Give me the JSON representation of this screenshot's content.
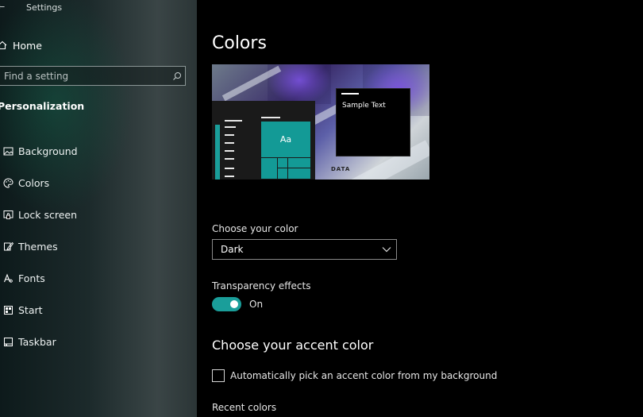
{
  "window": {
    "title": "Settings"
  },
  "sidebar": {
    "home_label": "Home",
    "search_placeholder": "Find a setting",
    "section_title": "Personalization",
    "items": [
      {
        "label": "Background",
        "icon": "picture-icon"
      },
      {
        "label": "Colors",
        "icon": "palette-icon"
      },
      {
        "label": "Lock screen",
        "icon": "lock-screen-icon"
      },
      {
        "label": "Themes",
        "icon": "brush-icon"
      },
      {
        "label": "Fonts",
        "icon": "font-icon"
      },
      {
        "label": "Start",
        "icon": "start-menu-icon"
      },
      {
        "label": "Taskbar",
        "icon": "taskbar-icon"
      }
    ]
  },
  "main": {
    "title": "Colors",
    "preview": {
      "tile_text": "Aa",
      "sample_text": "Sample Text",
      "logo_text": "DATA"
    },
    "choose_color": {
      "label": "Choose your color",
      "value": "Dark"
    },
    "transparency": {
      "label": "Transparency effects",
      "state": "On",
      "enabled": true
    },
    "accent_heading": "Choose your accent color",
    "auto_pick": {
      "label": "Automatically pick an accent color from my background",
      "checked": false
    },
    "recent_colors_label": "Recent colors"
  },
  "colors": {
    "accent": "#1a9e9a",
    "background": "#000000",
    "sidebar_dark": "#1c2a2b"
  }
}
